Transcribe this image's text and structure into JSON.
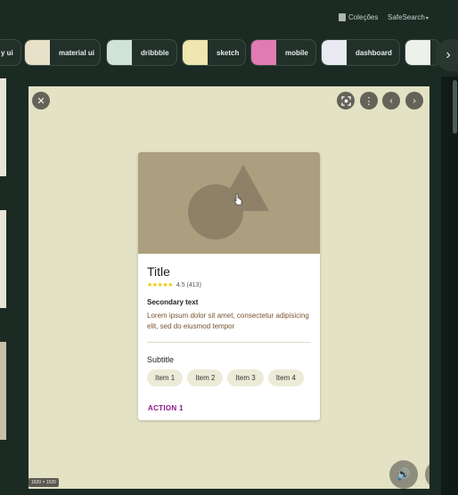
{
  "topbar": {
    "collections_label": "Coleções",
    "safesearch_label": "SafeSearch"
  },
  "chips": [
    {
      "label": "y ui"
    },
    {
      "label": "material ui"
    },
    {
      "label": "dribbble"
    },
    {
      "label": "sketch"
    },
    {
      "label": "mobile"
    },
    {
      "label": "dashboard"
    }
  ],
  "viewer": {
    "image_dimensions": "1520 × 1520"
  },
  "card": {
    "title": "Title",
    "rating_text": "4.5 (413)",
    "rating_value": 4.5,
    "secondary_text": "Secondary text",
    "description": "Lorem ipsum dolor sit amet, consectetur adipisicing elit, sed do eiusmod tempor",
    "subtitle": "Subtitle",
    "items": [
      "Item 1",
      "Item 2",
      "Item 3",
      "Item 4"
    ],
    "action_label": "ACTION 1"
  },
  "colors": {
    "page_bg": "#1c2a24",
    "viewer_bg": "#e3e2c4",
    "media_bg": "#ab9f7f",
    "shape_fill": "#8e8168",
    "star": "#f2c400",
    "action": "#8b1a8b"
  },
  "icons": [
    "collections-icon",
    "caret-down-icon",
    "chevron-right-icon",
    "close-icon",
    "lens-icon",
    "more-vert-icon",
    "chevron-left-icon",
    "volume-icon",
    "more-horiz-icon",
    "cursor-icon"
  ]
}
